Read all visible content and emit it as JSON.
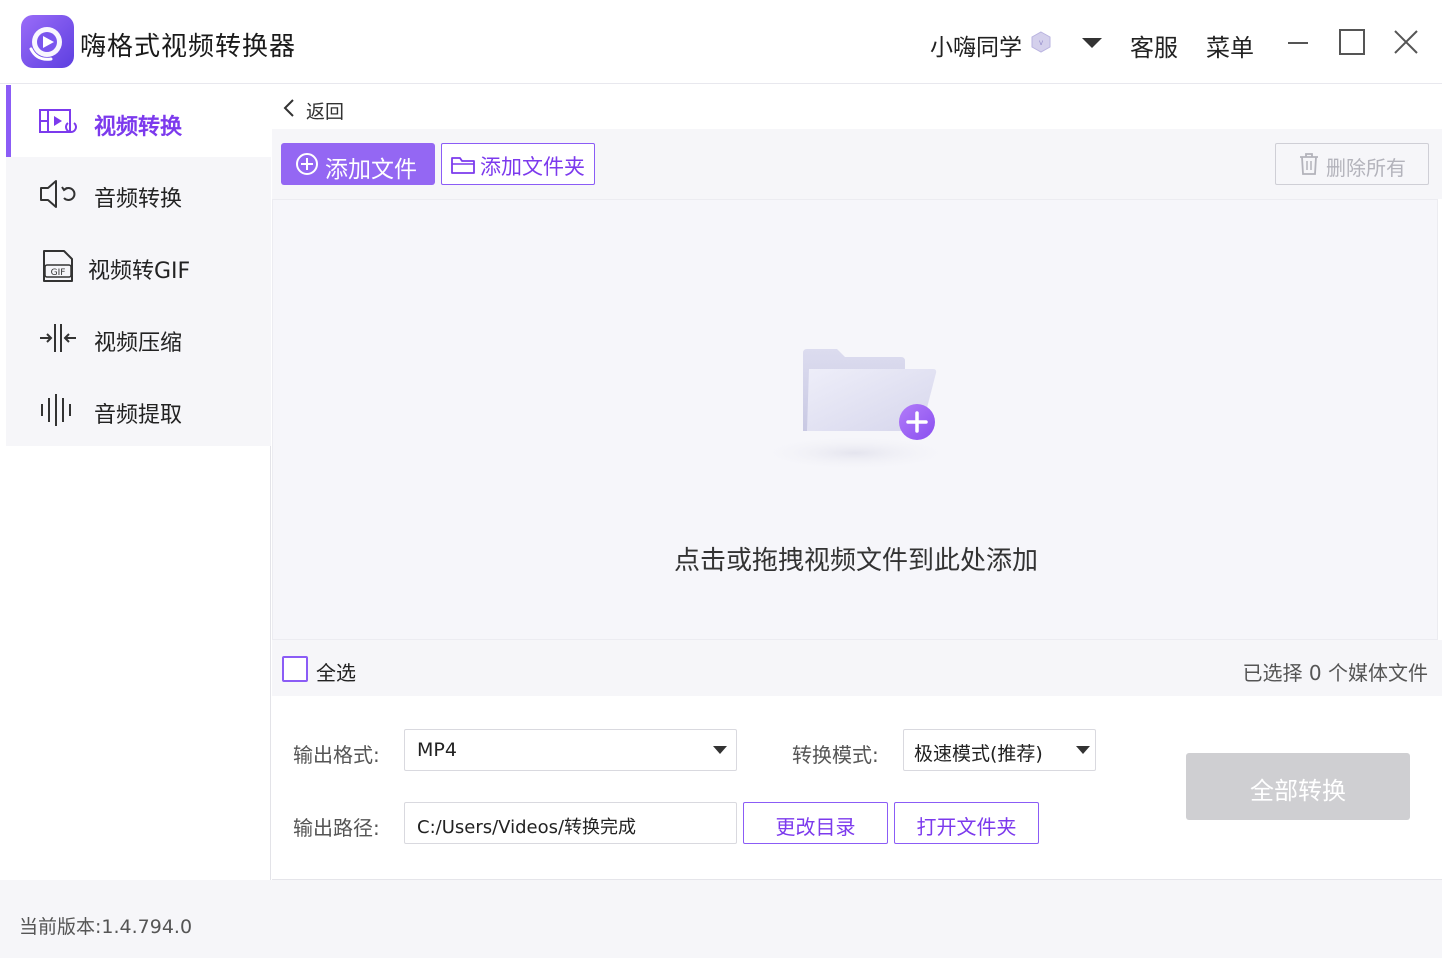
{
  "app": {
    "title": "嗨格式视频转换器"
  },
  "header": {
    "user_name": "小嗨同学",
    "service": "客服",
    "menu": "菜单"
  },
  "sidebar": {
    "items": [
      {
        "label": "视频转换",
        "icon": "video-convert-icon",
        "active": true
      },
      {
        "label": "音频转换",
        "icon": "audio-convert-icon",
        "active": false
      },
      {
        "label": "视频转GIF",
        "icon": "gif-icon",
        "active": false
      },
      {
        "label": "视频压缩",
        "icon": "compress-icon",
        "active": false
      },
      {
        "label": "音频提取",
        "icon": "audio-extract-icon",
        "active": false
      }
    ]
  },
  "nav": {
    "back_label": "返回"
  },
  "toolbar": {
    "add_file": "添加文件",
    "add_folder": "添加文件夹",
    "delete_all": "删除所有"
  },
  "dropzone": {
    "hint": "点击或拖拽视频文件到此处添加"
  },
  "selection": {
    "select_all": "全选",
    "count_text": "已选择 0 个媒体文件"
  },
  "settings": {
    "format_label": "输出格式:",
    "format_value": "MP4",
    "mode_label": "转换模式:",
    "mode_value": "极速模式(推荐)",
    "path_label": "输出路径:",
    "path_value": "C:/Users/Videos/转换完成",
    "change_dir": "更改目录",
    "open_folder": "打开文件夹",
    "convert_all": "全部转换"
  },
  "footer": {
    "version": "当前版本:1.4.794.0"
  },
  "colors": {
    "accent": "#8b5cf6",
    "accent_dark": "#7c3aed",
    "disabled": "#cfcfd2",
    "panel_bg": "#f6f6f9"
  }
}
